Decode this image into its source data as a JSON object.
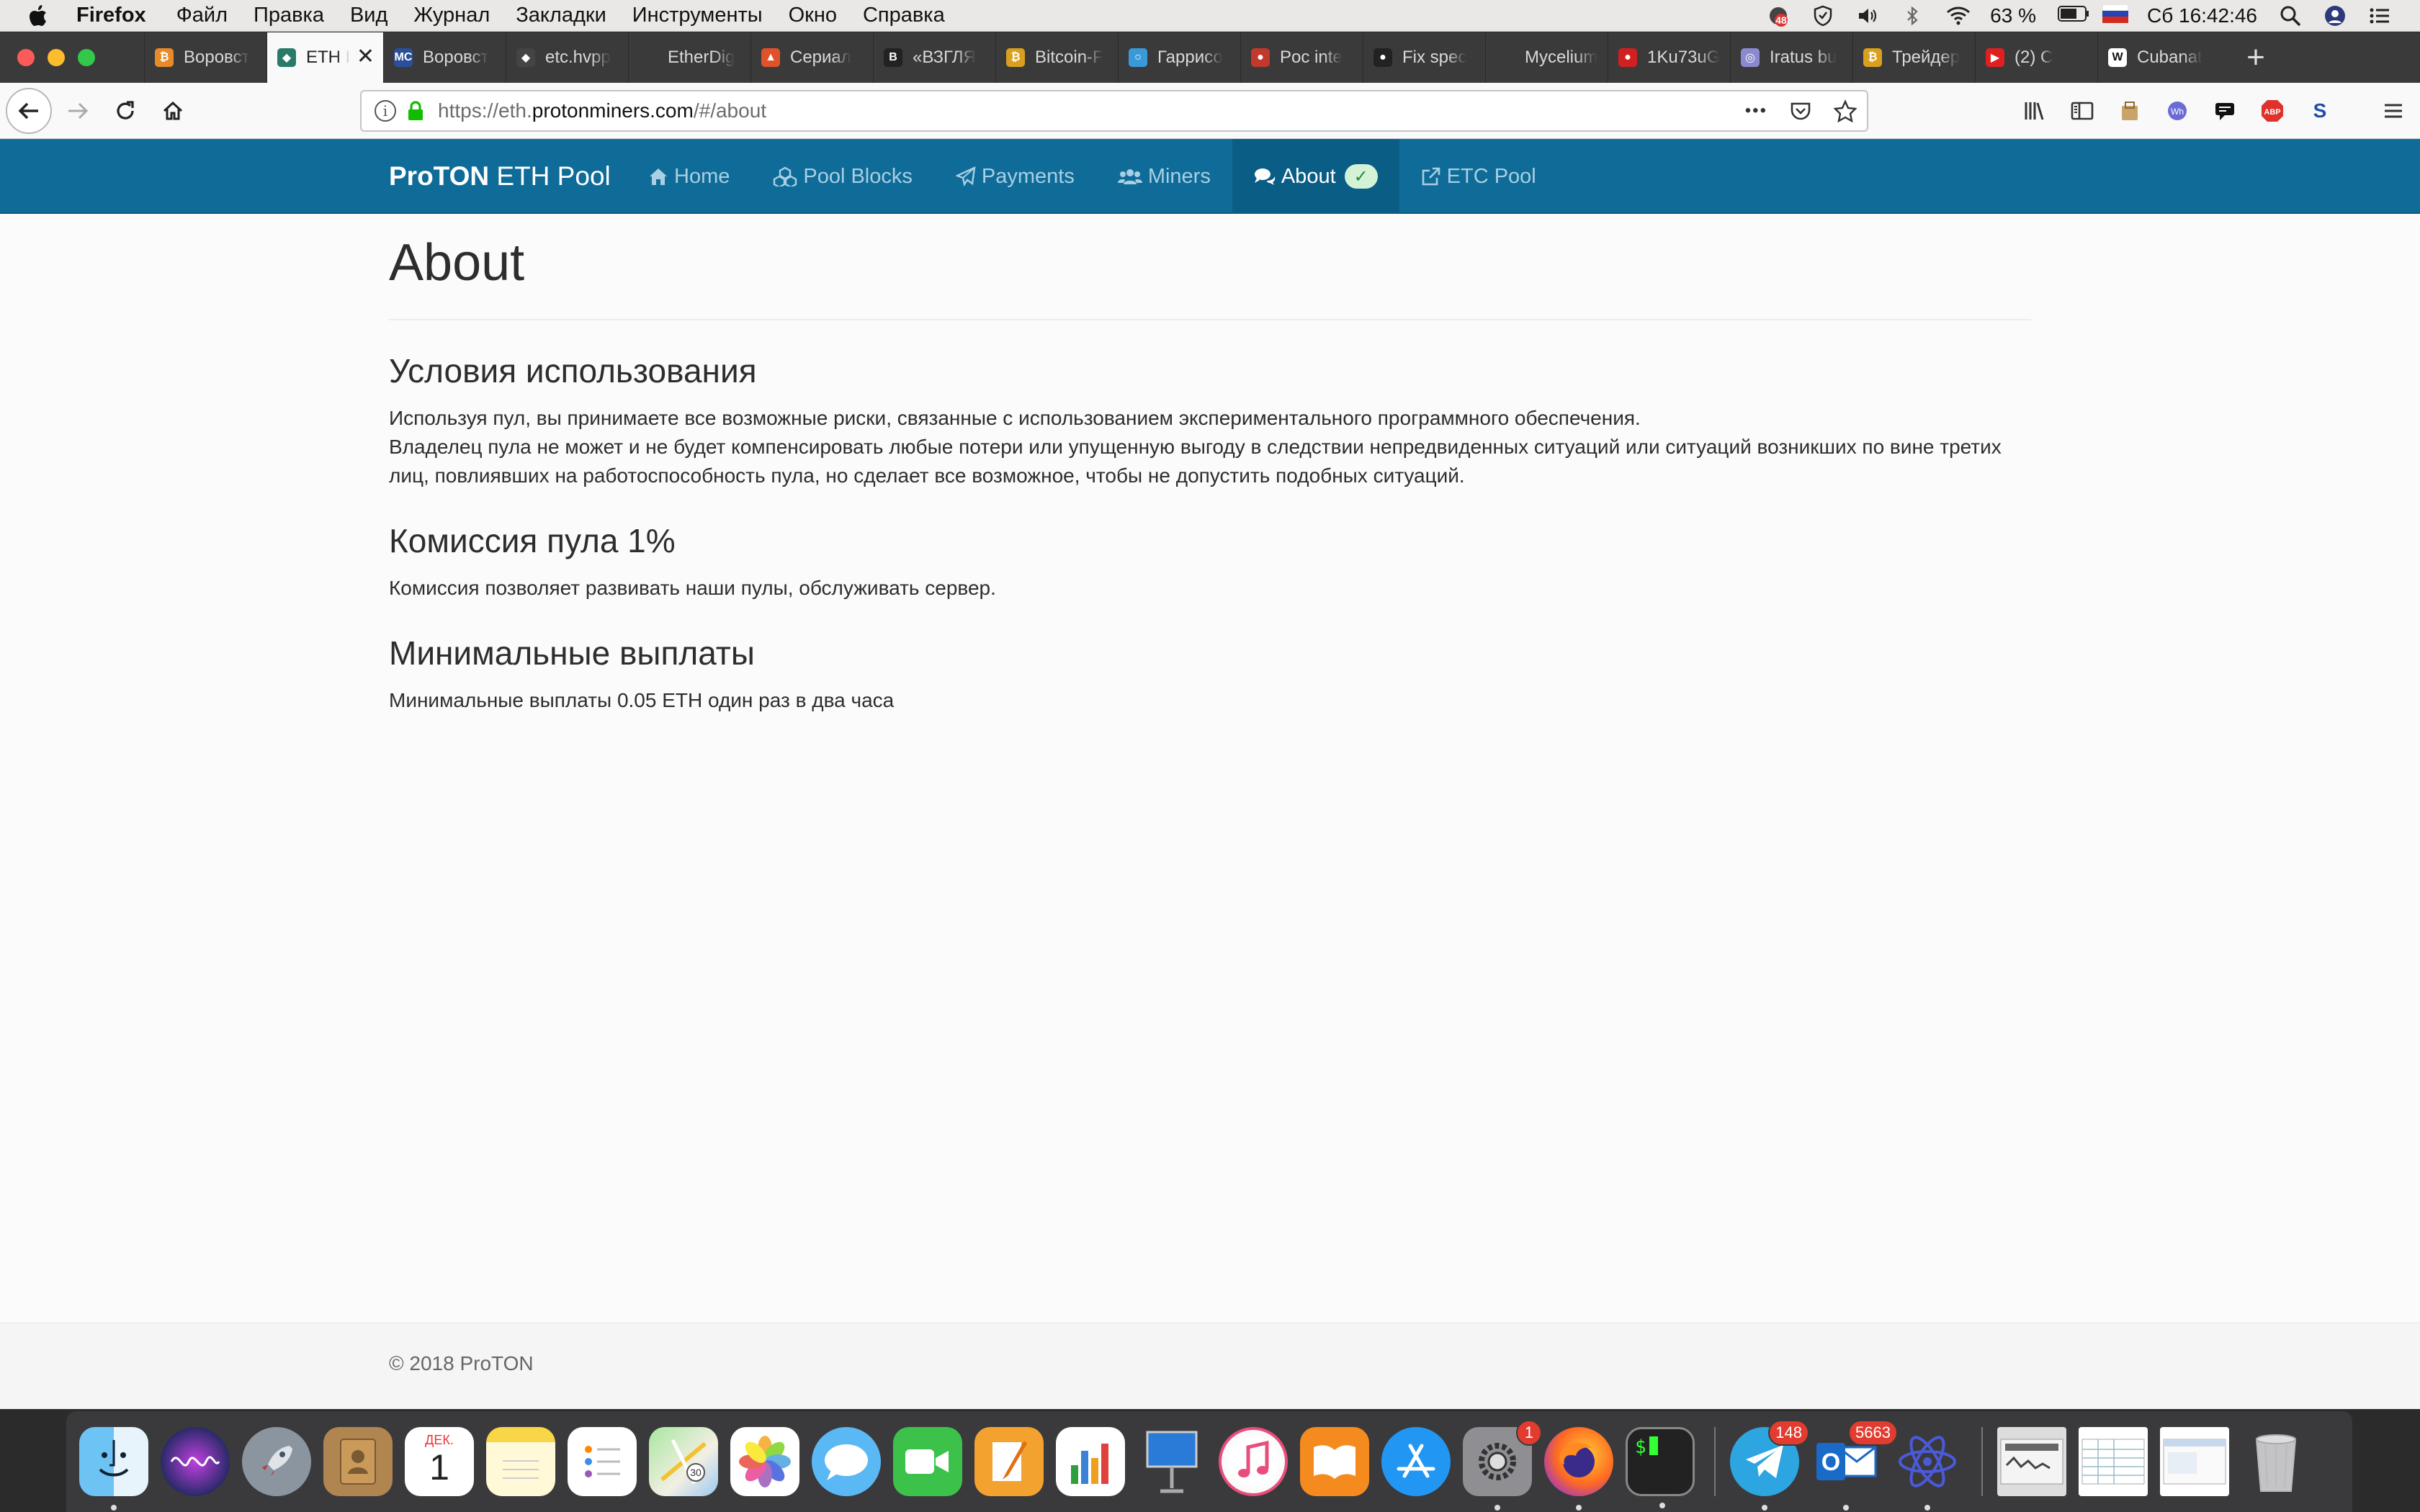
{
  "menubar": {
    "app": "Firefox",
    "items": [
      "Файл",
      "Правка",
      "Вид",
      "Журнал",
      "Закладки",
      "Инструменты",
      "Окно",
      "Справка"
    ],
    "notification_badge": "48",
    "battery": "63 %",
    "clock": "Сб 16:42:46"
  },
  "tabs": [
    {
      "title": "Воровст",
      "color": "#e88a2a",
      "glyph": "₿"
    },
    {
      "title": "ETH I",
      "color": "#2a7a6a",
      "glyph": "◆",
      "active": true
    },
    {
      "title": "Воровст",
      "color": "#2c4f9a",
      "glyph": "MC"
    },
    {
      "title": "etc.hvpp",
      "color": "#444444",
      "glyph": "◆"
    },
    {
      "title": "EtherDig",
      "color": "#3a3a3a",
      "glyph": ""
    },
    {
      "title": "Сериал",
      "color": "#e0522a",
      "glyph": "▲"
    },
    {
      "title": "«ВЗГЛЯ",
      "color": "#222222",
      "glyph": "B"
    },
    {
      "title": "Bitcoin-F",
      "color": "#d9a020",
      "glyph": "₿"
    },
    {
      "title": "Гаррисо",
      "color": "#3a9ad9",
      "glyph": "○"
    },
    {
      "title": "Poc inte",
      "color": "#c0392b",
      "glyph": "●"
    },
    {
      "title": "Fix spec",
      "color": "#222222",
      "glyph": "●"
    },
    {
      "title": "Mycelium Bl",
      "color": "#3a3a3a",
      "glyph": ""
    },
    {
      "title": "1Ku73uG",
      "color": "#d02020",
      "glyph": "●"
    },
    {
      "title": "Iratus bu",
      "color": "#8a8ad0",
      "glyph": "◎"
    },
    {
      "title": "Трейдер",
      "color": "#d9a020",
      "glyph": "₿"
    },
    {
      "title": "(2) C",
      "color": "#e02020",
      "glyph": "▶"
    },
    {
      "title": "Cubanat",
      "color": "#ffffff",
      "glyph": "W"
    }
  ],
  "tab_close": "✕",
  "new_tab": "+",
  "address": {
    "prefix": "https://eth.",
    "domain": "protonminers.com",
    "suffix": "/#/about",
    "menu_dots": "•••"
  },
  "site": {
    "brand_bold": "ProTON",
    "brand_rest": " ETH Pool",
    "nav": [
      {
        "label": "Home",
        "icon": "home-icon"
      },
      {
        "label": "Pool Blocks",
        "icon": "cubes-icon"
      },
      {
        "label": "Payments",
        "icon": "paper-plane-icon"
      },
      {
        "label": "Miners",
        "icon": "users-icon"
      },
      {
        "label": "About",
        "icon": "comments-icon",
        "active": true,
        "badge": "✓"
      },
      {
        "label": "ETC Pool",
        "icon": "external-link-icon"
      }
    ]
  },
  "content": {
    "title": "About",
    "sections": [
      {
        "heading": "Условия использования",
        "paragraphs": [
          "Используя пул, вы принимаете все возможные риски, связанные с использованием экспериментального программного обеспечения.",
          "Владелец пула не может и не будет компенсировать любые потери или упущенную выгоду в следствии непредвиденных ситуаций или ситуаций возникших по вине третих лиц, повлиявших на работоспособность пула, но сделает все возможное, чтобы не допустить подобных ситуаций."
        ]
      },
      {
        "heading": "Комиссия пула 1%",
        "paragraphs": [
          "Комиссия позволяет развивать наши пулы, обслуживать сервер."
        ]
      },
      {
        "heading": "Минимальные выплаты",
        "paragraphs": [
          "Минимальные выплаты 0.05 ETH один раз в два часа"
        ]
      }
    ]
  },
  "footer": {
    "text": "© 2018 ProTON"
  },
  "dock": {
    "calendar_month": "ДЕК.",
    "calendar_day": "1",
    "settings_badge": "1",
    "telegram_badge": "148",
    "outlook_badge": "5663",
    "terminal_prompt": "$"
  },
  "colors": {
    "nav_bg": "#0f6c98",
    "nav_active": "#0a5e86",
    "nav_link": "#a9cfe3",
    "badge_bg": "#d4f3d6"
  }
}
